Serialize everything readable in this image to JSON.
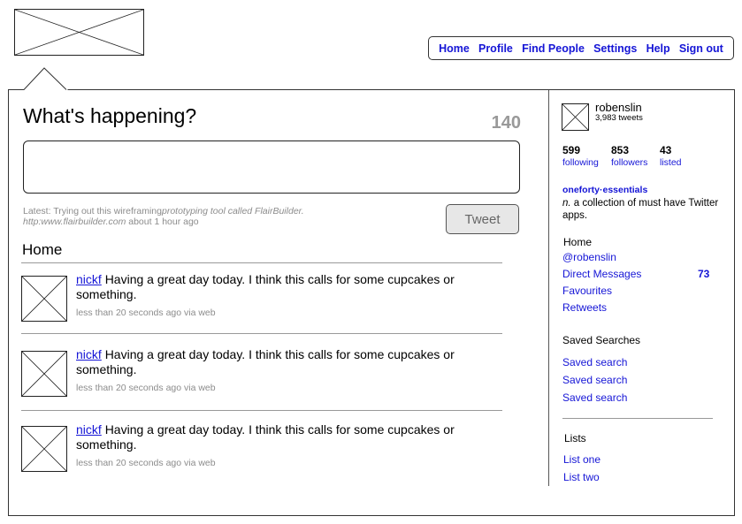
{
  "nav": {
    "items": [
      {
        "label": "Home"
      },
      {
        "label": "Profile"
      },
      {
        "label": "Find People"
      },
      {
        "label": "Settings"
      },
      {
        "label": "Help"
      },
      {
        "label": "Sign out"
      }
    ]
  },
  "composer": {
    "heading": "What's happening?",
    "char_count": "140",
    "button_label": "Tweet",
    "latest_prefix": "Latest: Trying out this wireframing",
    "latest_italic": "prototyping tool called FlairBuilder.",
    "latest_link": "http:www.flairbuilder.com",
    "latest_time": " about 1 hour ago"
  },
  "timeline": {
    "heading": "Home",
    "items": [
      {
        "user": "nickf",
        "text": "Having a great day today. I think this calls for some cupcakes or something.",
        "meta": "less than 20 seconds ago via web"
      },
      {
        "user": "nickf",
        "text": "Having a great day today. I think this calls for some cupcakes or something.",
        "meta": "less than 20 seconds ago via web"
      },
      {
        "user": "nickf",
        "text": "Having a great day today. I think this calls for some cupcakes or something.",
        "meta": "less than 20 seconds ago via web"
      }
    ]
  },
  "sidebar": {
    "username": "robenslin",
    "tweets": "3,983 tweets",
    "stats": [
      {
        "value": "599",
        "label": "following"
      },
      {
        "value": "853",
        "label": "followers"
      },
      {
        "value": "43",
        "label": "listed"
      }
    ],
    "oneforty_title": "oneforty·essentials",
    "oneforty_desc_italic": "n.",
    "oneforty_desc": " a collection of must have Twitter apps.",
    "home_label": "Home",
    "links": [
      "@robenslin",
      "Direct Messages",
      "Favourites",
      "Retweets"
    ],
    "dm_count": "73",
    "saved_heading": "Saved Searches",
    "saved": [
      "Saved search",
      "Saved search",
      "Saved search"
    ],
    "lists_heading": "Lists",
    "lists": [
      "List one",
      "List two"
    ]
  },
  "colors": {
    "link": "#1515d6",
    "muted": "#8c8c8c",
    "count": "#999999"
  },
  "icons": {
    "placeholder": "image-placeholder-icon"
  }
}
